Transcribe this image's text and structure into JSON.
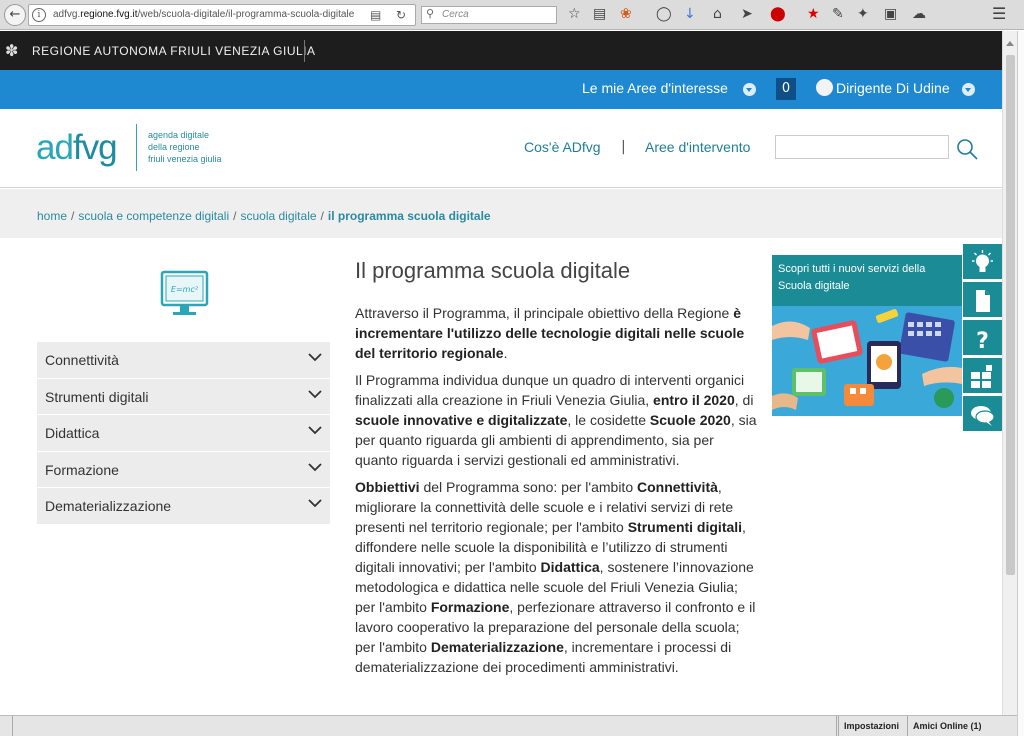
{
  "browser": {
    "url_prefix": "adfvg.",
    "url_domain": "regione.fvg.it",
    "url_path": "/web/scuola-digitale/il-programma-scuola-digitale",
    "search_placeholder": "Cerca"
  },
  "region_bar": {
    "name": "REGIONE AUTONOMA FRIULI VENEZIA GIULIA"
  },
  "top_nav": {
    "aree_label": "Le mie Aree d'interesse",
    "count": "0",
    "user_label": "Dirigente Di Udine"
  },
  "header": {
    "logo_ad": "ad",
    "logo_fvg": "fvg",
    "logo_sub_1": "agenda digitale",
    "logo_sub_2": "della regione",
    "logo_sub_3": "friuli venezia giulia",
    "link_cos": "Cos'è ADfvg",
    "link_pipe": "|",
    "link_aree": "Aree d'intervento",
    "search_value": ""
  },
  "breadcrumb": {
    "items": [
      "home",
      "scuola e competenze digitali",
      "scuola digitale",
      "il programma scuola digitale"
    ],
    "separator": "/"
  },
  "sidebar": {
    "items": [
      {
        "label": "Connettività"
      },
      {
        "label": "Strumenti digitali"
      },
      {
        "label": "Didattica"
      },
      {
        "label": "Formazione"
      },
      {
        "label": "Dematerializzazione"
      }
    ]
  },
  "article": {
    "title": "Il programma scuola digitale",
    "p1": [
      "Attraverso il Programma, il principale obiettivo della Regione ",
      "è incrementare l'utilizzo delle tecnologie digitali nelle scuole del territorio regionale",
      "."
    ],
    "p2": [
      "Il Programma individua dunque un quadro di interventi organici finalizzati alla creazione in Friuli Venezia Giulia, ",
      "entro il 2020",
      ", di ",
      "scuole innovative e digitalizzate",
      ", le cosidette ",
      "Scuole 2020",
      ", sia per quanto riguarda gli ambienti di apprendimento, sia per quanto riguarda i servizi gestionali ed amministrativi."
    ],
    "p3": [
      "Obbiettivi",
      " del Programma sono: per l'ambito ",
      "Connettività",
      ", migliorare la connettività delle scuole e i relativi servizi di rete presenti nel territorio regionale; per l'ambito ",
      "Strumenti digitali",
      ", diffondere nelle scuole la disponibilità e l’utilizzo di strumenti digitali innovativi; per l'ambito ",
      "Didattica",
      ", sostenere l’innovazione metodologica e didattica nelle scuole del Friuli Venezia Giulia; per l'ambito ",
      "Formazione",
      ", perfezionare attraverso il confronto e il lavoro cooperativo la preparazione del personale della scuola; per l'ambito ",
      "Dematerializzazione",
      ", incrementare i processi di dematerializzazione dei procedimenti amministrativi."
    ]
  },
  "promo": {
    "text": "Scopri tutti i nuovi servizi della Scuola digitale"
  },
  "side_icons": [
    "lightbulb-icon",
    "document-icon",
    "question-icon",
    "services-icon",
    "chat-icon"
  ],
  "status_bar": {
    "settings": "Impostazioni",
    "online": "Amici Online (1)"
  },
  "colors": {
    "accent_blue": "#1e88d0",
    "teal": "#1b8c95",
    "dark_bar": "#1d1d1d"
  }
}
